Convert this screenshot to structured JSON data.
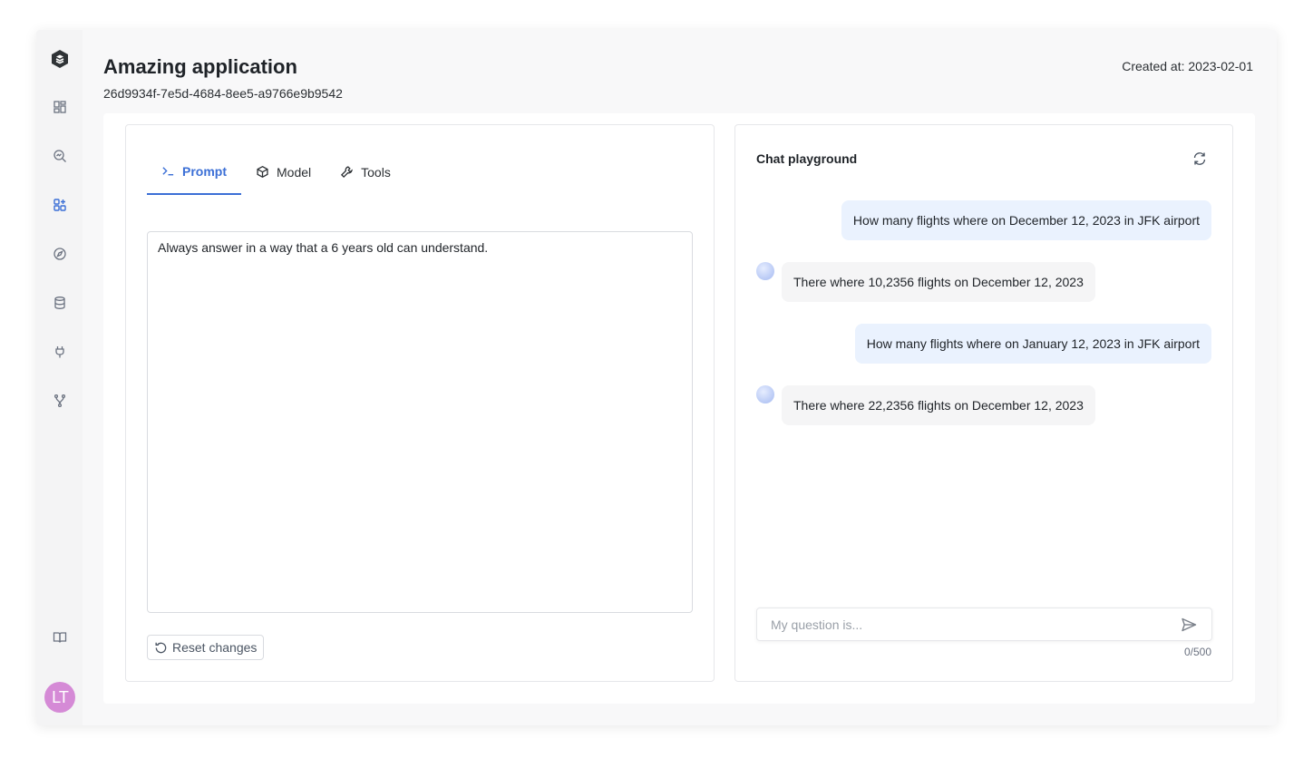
{
  "app": {
    "title": "Amazing application",
    "id": "26d9934f-7e5d-4684-8ee5-a9766e9b9542",
    "created": "Created at: 2023-02-01"
  },
  "sidebar": {
    "logo_icon": "stack-logo-icon",
    "items": [
      {
        "icon": "dashboard-icon",
        "active": false
      },
      {
        "icon": "search-analytics-icon",
        "active": false
      },
      {
        "icon": "apps-add-icon",
        "active": true
      },
      {
        "icon": "compass-icon",
        "active": false
      },
      {
        "icon": "database-icon",
        "active": false
      },
      {
        "icon": "plug-icon",
        "active": false
      },
      {
        "icon": "git-fork-icon",
        "active": false
      }
    ],
    "docs_icon": "book-icon",
    "avatar_initials": "LT",
    "avatar_color": "#d58ad6"
  },
  "editor": {
    "tabs": [
      {
        "label": "Prompt",
        "icon": "terminal-icon",
        "active": true
      },
      {
        "label": "Model",
        "icon": "cube-icon",
        "active": false
      },
      {
        "label": "Tools",
        "icon": "wrench-icon",
        "active": false
      }
    ],
    "prompt_text": "Always answer in a way that a 6 years old can understand.",
    "reset_label": "Reset changes"
  },
  "chat": {
    "title": "Chat playground",
    "messages": [
      {
        "role": "user",
        "text": "How many flights where on December 12, 2023 in JFK airport"
      },
      {
        "role": "bot",
        "text": "There where 10,2356 flights on December 12, 2023"
      },
      {
        "role": "user",
        "text": "How many flights where on January 12, 2023 in JFK airport"
      },
      {
        "role": "bot",
        "text": "There where 22,2356 flights on December 12, 2023"
      }
    ],
    "input_placeholder": "My question is...",
    "counter": "0/500"
  },
  "colors": {
    "accent": "#3b6fd6",
    "user_bubble": "#eaf2fe",
    "bot_bubble": "#f5f5f6"
  }
}
